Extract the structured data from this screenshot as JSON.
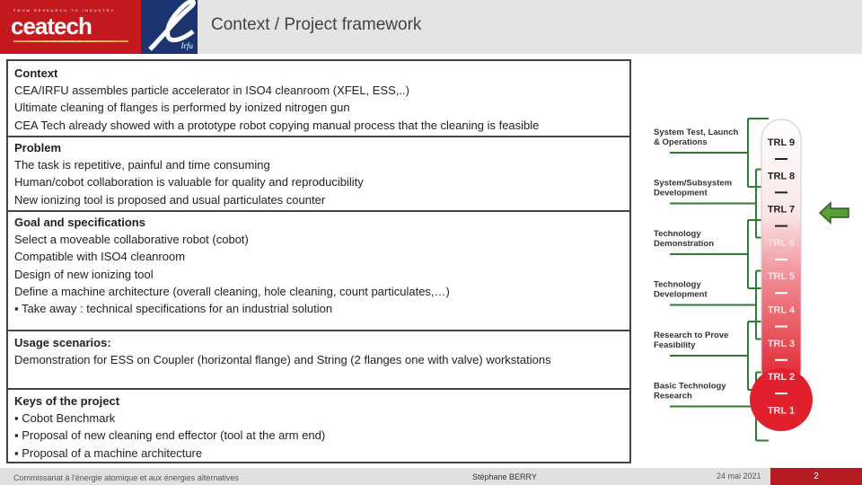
{
  "header": {
    "title": "Context / Project framework",
    "logo_cea_text": "ceatech",
    "logo_cea_tagline": "FROM RESEARCH TO INDUSTRY",
    "logo_irfu_text": "Irfu"
  },
  "sections": [
    {
      "heading": "Context",
      "lines": [
        "CEA/IRFU  assembles particle accelerator in ISO4 cleanroom (XFEL, ESS,..)",
        "Ultimate cleaning of flanges is performed by ionized nitrogen gun",
        "CEA Tech   already showed with a prototype robot copying manual process that the cleaning is feasible"
      ]
    },
    {
      "heading": "Problem",
      "lines": [
        "The task is repetitive, painful and time consuming",
        "Human/cobot collaboration is valuable for quality and reproducibility",
        "New ionizing tool is proposed and usual particulates counter"
      ]
    },
    {
      "heading": "Goal and specifications",
      "lines": [
        "Select a moveable collaborative robot (cobot)",
        "Compatible with ISO4 cleanroom",
        "Design of new ionizing tool",
        "Define a machine architecture (overall cleaning, hole cleaning, count particulates,…)",
        "▪ Take away : technical specifications for an industrial solution"
      ]
    },
    {
      "heading": "Usage scenarios:",
      "lines": [
        "Demonstration for ESS on Coupler (horizontal flange) and String (2 flanges one with valve) workstations"
      ]
    },
    {
      "heading": "Keys of the project",
      "lines": [
        "▪ Cobot Benchmark",
        "▪ Proposal of new cleaning end effector (tool at the arm end)",
        "▪ Proposal of a machine architecture"
      ]
    }
  ],
  "trl": {
    "levels": [
      "TRL 9",
      "TRL 8",
      "TRL 7",
      "TRL 6",
      "TRL 5",
      "TRL 4",
      "TRL 3",
      "TRL 2",
      "TRL 1"
    ],
    "categories": [
      "System Test, Launch & Operations",
      "System/Subsystem Development",
      "Technology Demonstration",
      "Technology Development",
      "Research to Prove Feasibility",
      "Basic Technology Research"
    ],
    "current_level": "TRL 7",
    "arrow_color": "#5a9e3a",
    "line_color": "#2e7d32",
    "bulb_color": "#e0202c"
  },
  "footer": {
    "organization": "Commissariat à l'énergie atomique et aux énergies alternatives",
    "author": "Stéphane BERRY",
    "date": "24 mai 2021",
    "page": "2"
  }
}
